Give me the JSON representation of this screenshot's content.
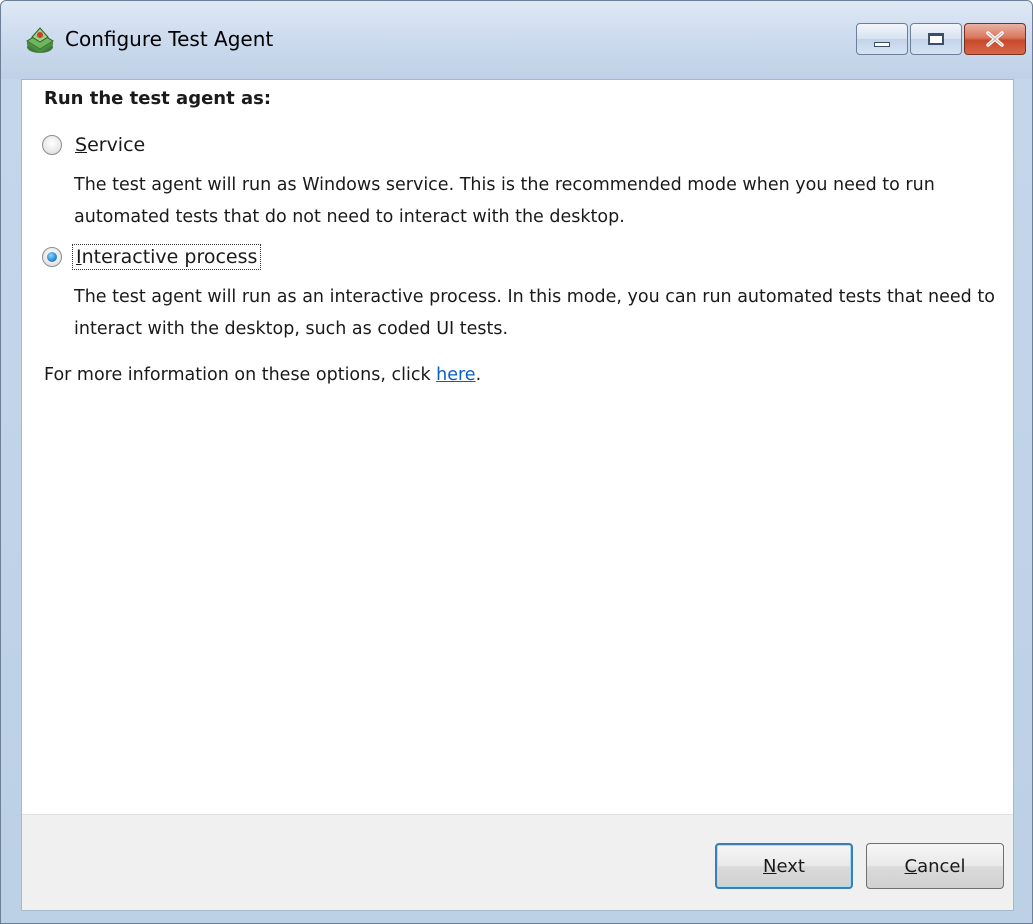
{
  "window": {
    "title": "Configure Test Agent"
  },
  "content": {
    "heading": "Run the test agent as:",
    "options": [
      {
        "label_mnemonic": "S",
        "label_rest": "ervice",
        "checked": false,
        "description": "The test agent will run as Windows service. This is the recommended mode when you need to run automated tests that do not need to interact with the desktop."
      },
      {
        "label_mnemonic": "I",
        "label_rest": "nteractive process",
        "checked": true,
        "description": "The test agent will run as an interactive process. In this mode, you can run automated tests that need to interact with the desktop, such as coded UI tests."
      }
    ],
    "info_prefix": "For more information on these options, click ",
    "info_link": "here",
    "info_suffix": "."
  },
  "footer": {
    "next_mnemonic": "N",
    "next_rest": "ext",
    "cancel_mnemonic": "C",
    "cancel_rest": "ancel"
  },
  "colors": {
    "link": "#0b5fc4",
    "radio_checked": "#2e8fd6",
    "default_button_border": "#3c7fb1"
  },
  "icons": {
    "app": "test-agent-icon",
    "minimize": "minimize-icon",
    "maximize": "maximize-icon",
    "close": "close-icon"
  }
}
